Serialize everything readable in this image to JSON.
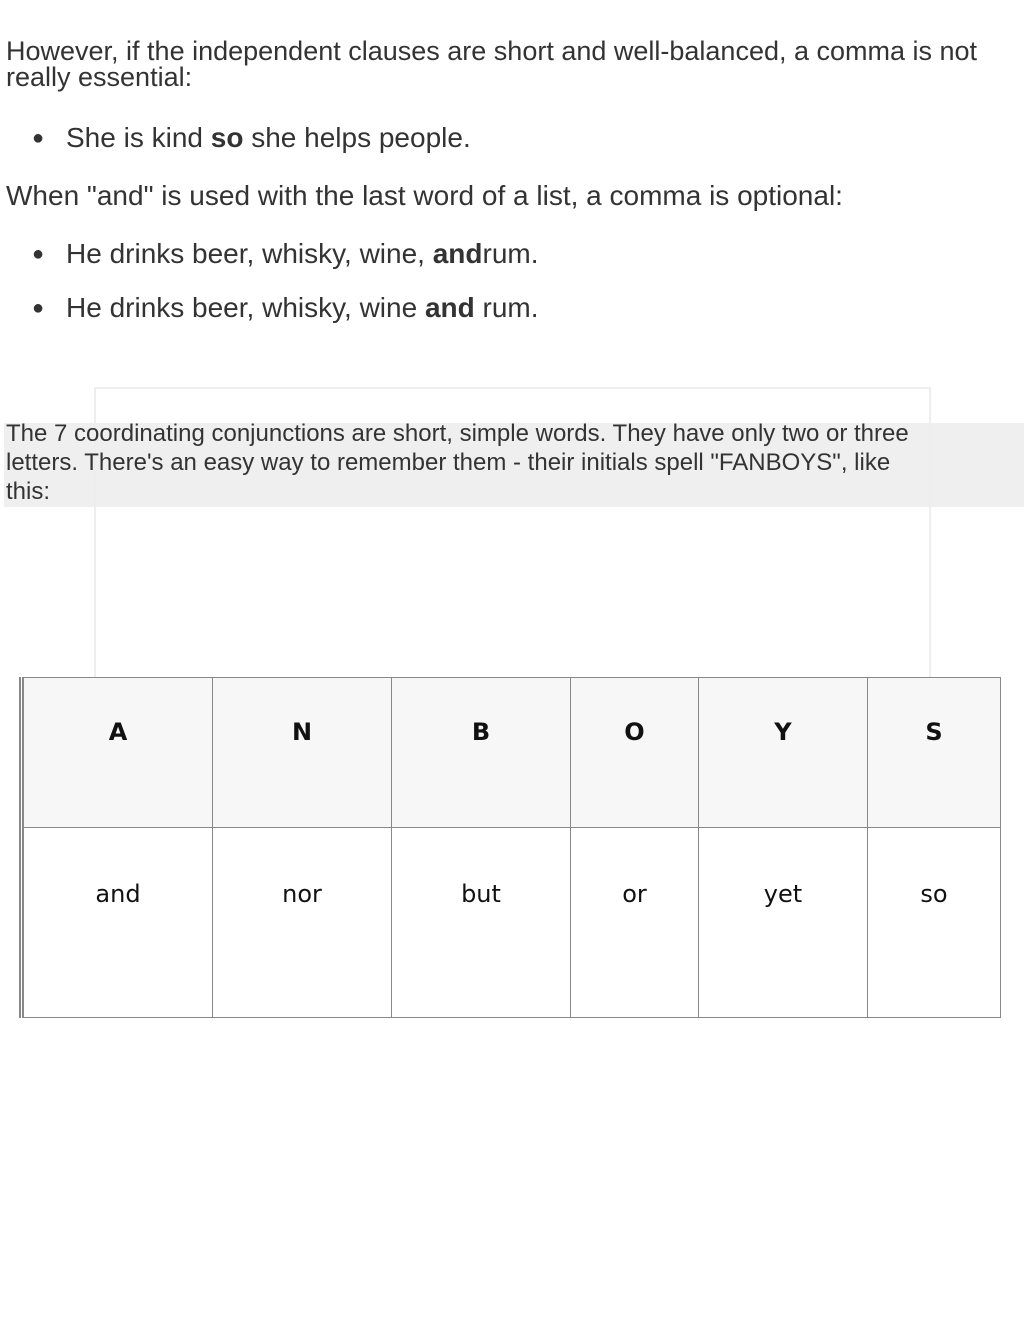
{
  "paragraph1": "However, if the independent clauses are short and well-balanced, a comma is  not really essential:",
  "bullet1": {
    "before": "She is kind ",
    "bold": "so",
    "after": " she helps people."
  },
  "paragraph2": "When \"and\" is used with the last word of a list, a comma is optional:",
  "bullet2": {
    "before": "He drinks beer, whisky, wine, ",
    "bold": "and",
    "after": "rum."
  },
  "bullet3": {
    "before": "He drinks beer, whisky, wine ",
    "bold": "and",
    "after": " rum."
  },
  "paragraph3": "The 7 coordinating conjunctions are short, simple words. They have only  two or three letters. There's an easy way to remember them - their initials spell \"FANBOYS\", like this:",
  "table": {
    "headers": [
      "A",
      "N",
      "B",
      "O",
      "Y",
      "S"
    ],
    "values": [
      "and",
      "nor",
      "but",
      "or",
      "yet",
      "so"
    ]
  }
}
